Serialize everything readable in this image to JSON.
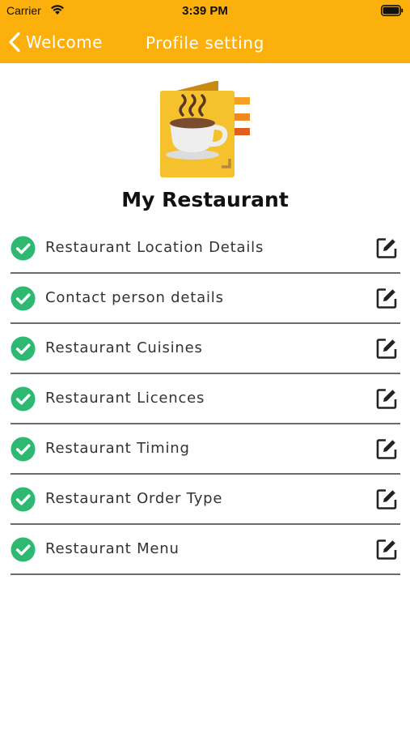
{
  "status_bar": {
    "carrier": "Carrier",
    "time": "3:39 PM",
    "icons": [
      "wifi-icon",
      "battery-icon"
    ]
  },
  "nav": {
    "back_label": "Welcome",
    "title": "Profile setting",
    "back_icon": "chevron-left-icon"
  },
  "colors": {
    "header": "#fbb00b",
    "check": "#2eb872",
    "divider": "#6b6b6b"
  },
  "profile": {
    "logo_icon": "menu-book-coffee-icon",
    "name": "My Restaurant"
  },
  "settings": {
    "items": [
      {
        "label": "Restaurant Location Details",
        "status_icon": "check-circle-icon",
        "action_icon": "edit-icon"
      },
      {
        "label": "Contact person details",
        "status_icon": "check-circle-icon",
        "action_icon": "edit-icon"
      },
      {
        "label": "Restaurant Cuisines",
        "status_icon": "check-circle-icon",
        "action_icon": "edit-icon"
      },
      {
        "label": "Restaurant Licences",
        "status_icon": "check-circle-icon",
        "action_icon": "edit-icon"
      },
      {
        "label": "Restaurant Timing",
        "status_icon": "check-circle-icon",
        "action_icon": "edit-icon"
      },
      {
        "label": "Restaurant Order Type",
        "status_icon": "check-circle-icon",
        "action_icon": "edit-icon"
      },
      {
        "label": "Restaurant Menu",
        "status_icon": "check-circle-icon",
        "action_icon": "edit-icon"
      }
    ]
  }
}
